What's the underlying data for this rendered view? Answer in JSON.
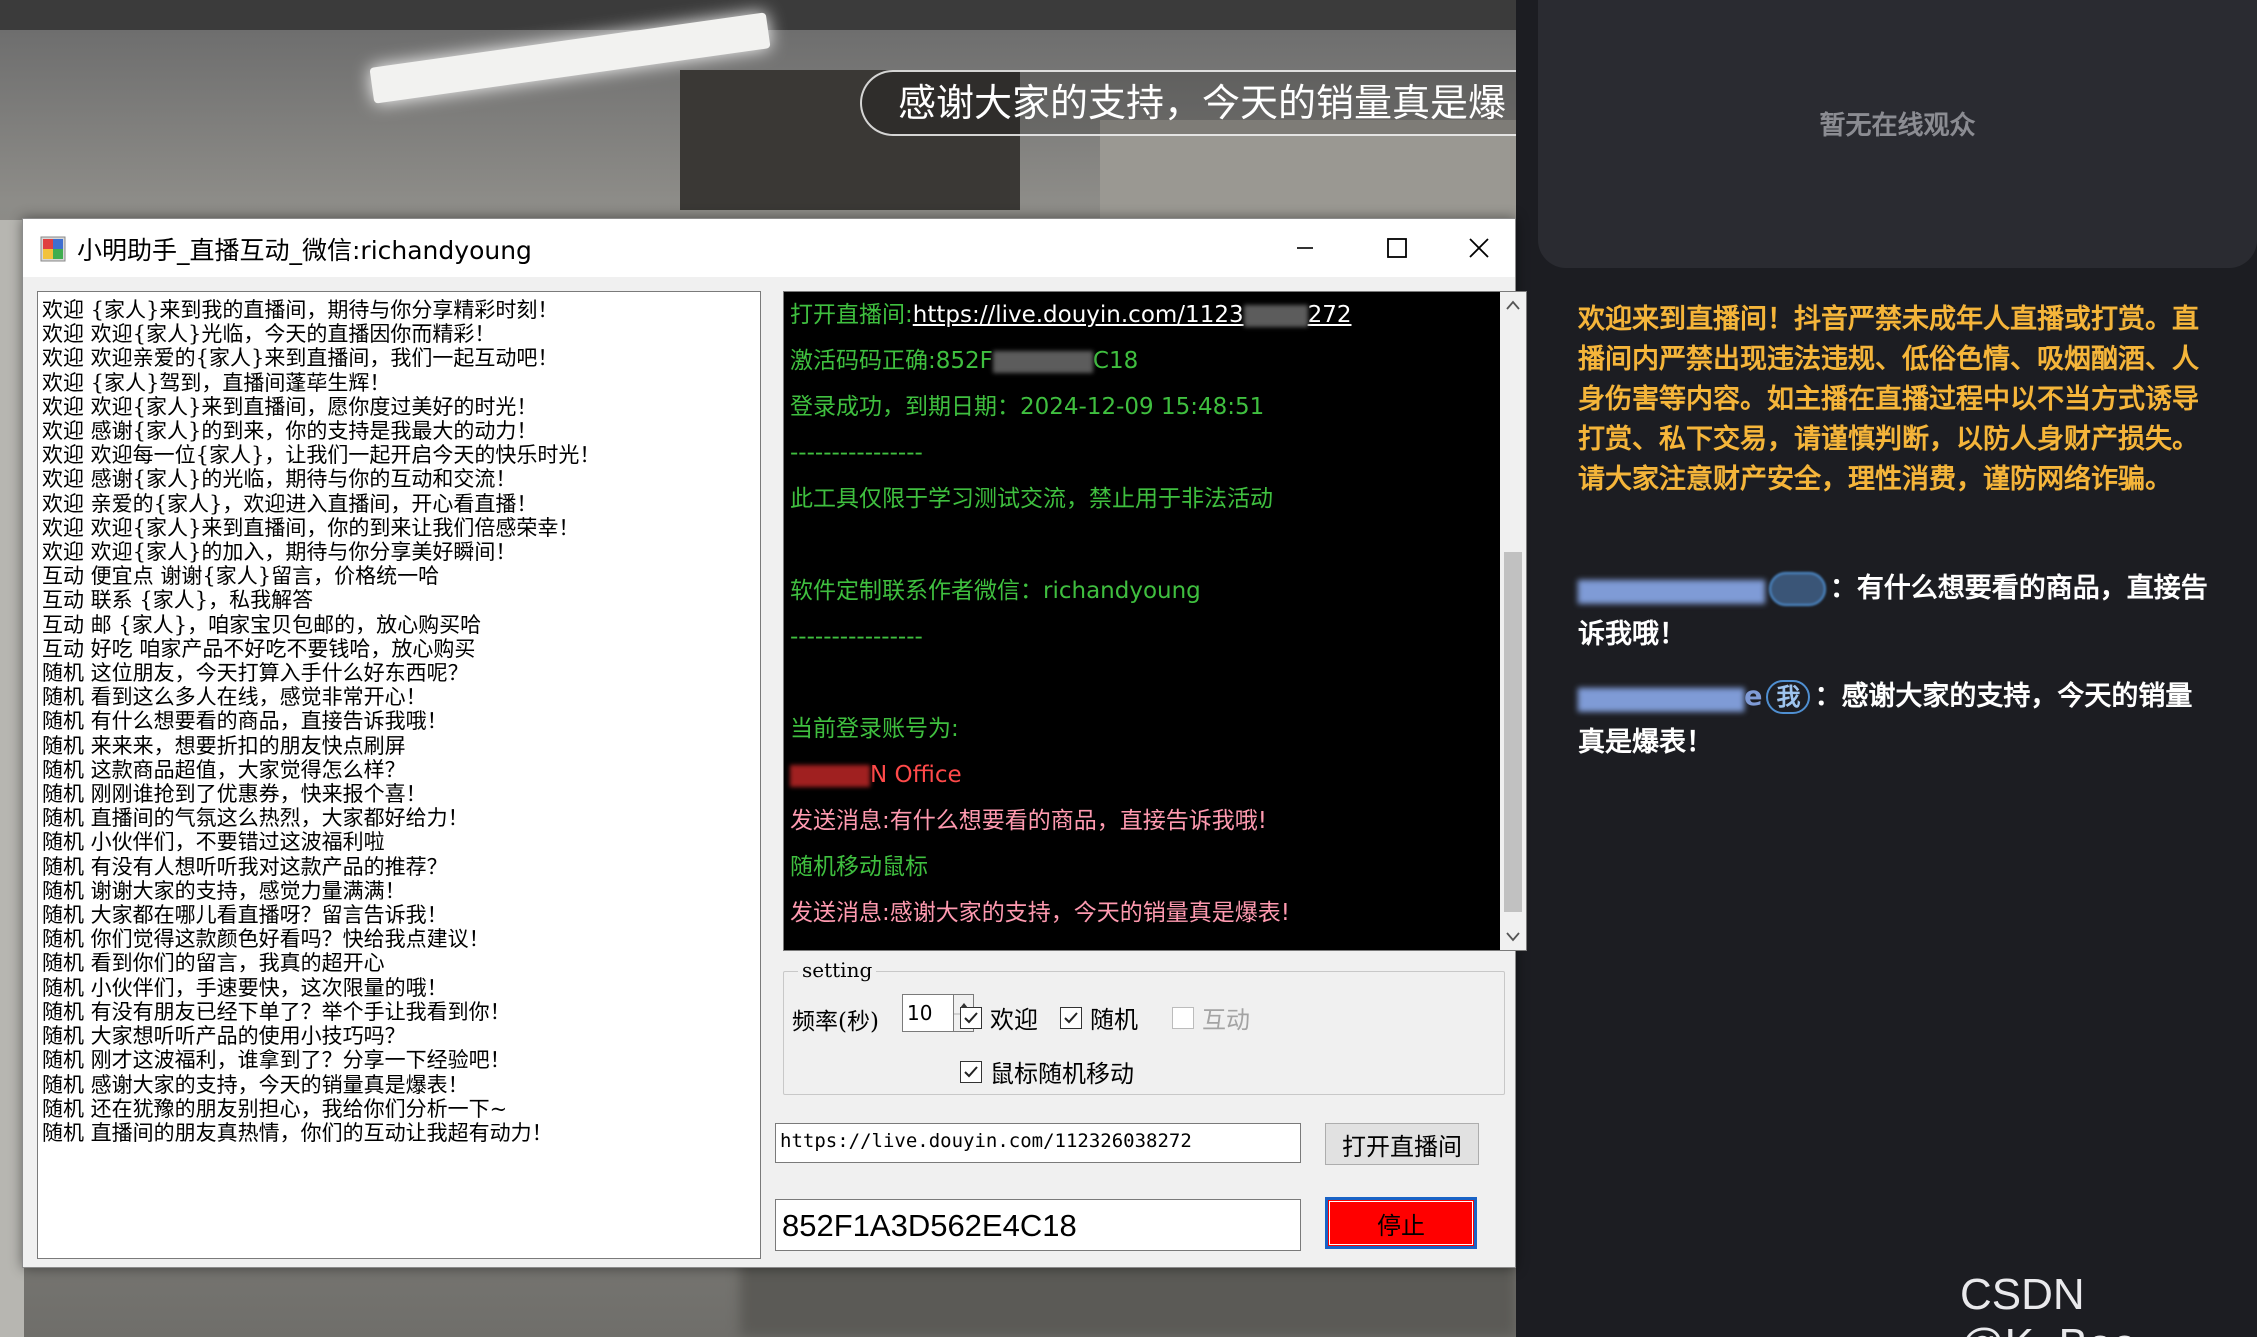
{
  "video": {
    "caption": "感谢大家的支持，今天的销量真是爆"
  },
  "app": {
    "title": "小明助手_直播互动_微信:richandyoung",
    "messages": [
      "欢迎 {家人}来到我的直播间，期待与你分享精彩时刻！",
      "欢迎 欢迎{家人}光临，今天的直播因你而精彩！",
      "欢迎 欢迎亲爱的{家人}来到直播间，我们一起互动吧！",
      "欢迎 {家人}驾到，直播间蓬荜生辉！",
      "欢迎 欢迎{家人}来到直播间，愿你度过美好的时光！",
      "欢迎 感谢{家人}的到来，你的支持是我最大的动力！",
      "欢迎 欢迎每一位{家人}，让我们一起开启今天的快乐时光！",
      "欢迎 感谢{家人}的光临，期待与你的互动和交流！",
      "欢迎 亲爱的{家人}，欢迎进入直播间，开心看直播！",
      "欢迎 欢迎{家人}来到直播间，你的到来让我们倍感荣幸！",
      "欢迎 欢迎{家人}的加入，期待与你分享美好瞬间！",
      "互动 便宜点 谢谢{家人}留言，价格统一哈",
      "互动 联系 {家人}，私我解答",
      "互动 邮 {家人}，咱家宝贝包邮的，放心购买哈",
      "互动 好吃 咱家产品不好吃不要钱哈，放心购买",
      "随机 这位朋友，今天打算入手什么好东西呢？",
      "随机 看到这么多人在线，感觉非常开心！",
      "随机 有什么想要看的商品，直接告诉我哦！",
      "随机 来来来，想要折扣的朋友快点刷屏",
      "随机 这款商品超值，大家觉得怎么样？",
      "随机 刚刚谁抢到了优惠券，快来报个喜！",
      "随机 直播间的气氛这么热烈，大家都好给力！",
      "随机 小伙伴们，不要错过这波福利啦",
      "随机 有没有人想听听我对这款产品的推荐？",
      "随机 谢谢大家的支持，感觉力量满满！",
      "随机 大家都在哪儿看直播呀？留言告诉我！",
      "随机 你们觉得这款颜色好看吗？快给我点建议！",
      "随机 看到你们的留言，我真的超开心",
      "随机 小伙伴们，手速要快，这次限量的哦！",
      "随机 有没有朋友已经下单了？举个手让我看到你！",
      "随机 大家想听听产品的使用小技巧吗？",
      "随机 刚才这波福利，谁拿到了？分享一下经验吧！",
      "随机 感谢大家的支持，今天的销量真是爆表！",
      "随机 还在犹豫的朋友别担心，我给你们分析一下~",
      "随机 直播间的朋友真热情，你们的互动让我超有动力！"
    ],
    "console": {
      "open_prefix": "打开直播间:",
      "open_link_a": "https://live.douyin.com/1123",
      "open_link_b": "272",
      "activation_prefix": "激活码码正确:852F",
      "activation_suffix": "C18",
      "login": "登录成功，到期日期：2024-12-09 15:48:51",
      "divider1": "----------------",
      "disclaimer": "此工具仅限于学习测试交流，禁止用于非法活动",
      "contact": "软件定制联系作者微信：richandyoung",
      "divider2": "----------------",
      "account_label": "当前登录账号为:",
      "account_name_suffix": "N Office",
      "sent1": "发送消息:有什么想要看的商品，直接告诉我哦!",
      "mouse": "随机移动鼠标",
      "sent2": "发送消息:感谢大家的支持，今天的销量真是爆表!"
    },
    "setting": {
      "legend": "setting",
      "freq_label": "频率(秒)",
      "freq_value": "10",
      "cb_welcome": "欢迎",
      "cb_random": "随机",
      "cb_interact": "互动",
      "cb_mouse": "鼠标随机移动"
    },
    "url_value": "https://live.douyin.com/112326038272",
    "open_button": "打开直播间",
    "code_value": "852F1A3D562E4C18",
    "stop_button": "停止"
  },
  "right_panel": {
    "audience_empty": "暂无在线观众",
    "notice": "欢迎来到直播间！抖音严禁未成年人直播或打赏。直播间内严禁出现违法违规、低俗色情、吸烟酗酒、人身伤害等内容。如主播在直播过程中以不当方式诱导打赏、私下交易，请谨慎判断，以防人身财产损失。请大家注意财产安全，理性消费，谨防网络诈骗。",
    "chat": [
      {
        "name_suffix": "",
        "badge": "",
        "text": "有什么想要看的商品，直接告诉我哦！"
      },
      {
        "name_suffix": "e",
        "badge": "我",
        "text": "感谢大家的支持，今天的销量真是爆表！"
      }
    ],
    "watermark": "CSDN @K_Bee"
  },
  "colors": {
    "stop_button": "#ff0000",
    "notice_text": "#f5b53a",
    "console_bg": "#000000",
    "console_green": "#3fbf3f"
  }
}
